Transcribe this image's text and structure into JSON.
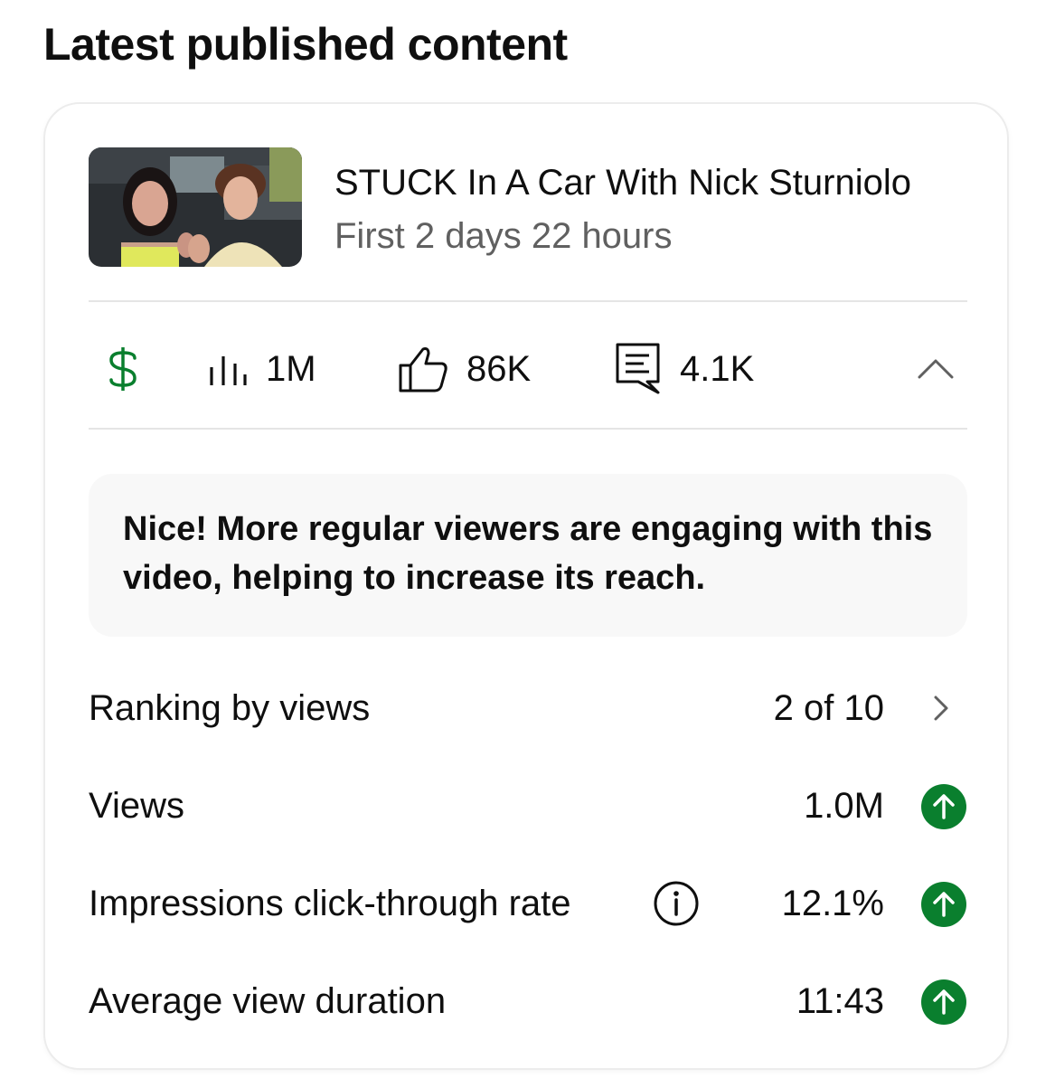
{
  "section": {
    "title": "Latest published content"
  },
  "video": {
    "title": "STUCK In A Car With Nick Sturniolo",
    "subtitle": "First 2 days 22 hours",
    "thumbnail_icon": "video-thumbnail"
  },
  "stats": {
    "monetization_icon": "dollar-icon",
    "views": "1M",
    "likes": "86K",
    "comments": "4.1K"
  },
  "insight": {
    "text": "Nice! More regular viewers are engaging with this video, helping to increase its reach."
  },
  "metrics": [
    {
      "label": "Ranking by views",
      "value": "2 of 10",
      "action": "chevron-right-icon"
    },
    {
      "label": "Views",
      "value": "1.0M",
      "trend": "up"
    },
    {
      "label": "Impressions click-through rate",
      "value": "12.1%",
      "trend": "up",
      "info": true
    },
    {
      "label": "Average view duration",
      "value": "11:43",
      "trend": "up"
    }
  ],
  "colors": {
    "accent_green": "#0a7f2e",
    "text_primary": "#0f0f0f",
    "text_secondary": "#606060",
    "divider": "#e5e5e5",
    "note_background": "#f8f8f8"
  }
}
